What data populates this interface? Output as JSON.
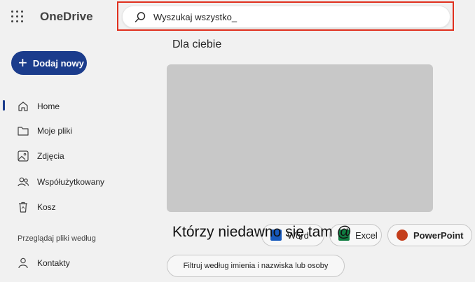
{
  "app": {
    "name": "OneDrive"
  },
  "search": {
    "value": "Wyszukaj wszystko"
  },
  "add_button": {
    "label": "Dodaj nowy"
  },
  "nav": {
    "items": [
      {
        "label": "Home",
        "icon": "home-icon",
        "active": true
      },
      {
        "label": "Moje pliki",
        "icon": "folder-icon"
      },
      {
        "label": "Zdjęcia",
        "icon": "image-icon"
      },
      {
        "label": "Współużytkowany",
        "icon": "people-icon"
      },
      {
        "label": "Kosz",
        "icon": "recycle-bin-icon"
      }
    ],
    "browse_section": "Przeglądaj pliki według",
    "contacts": {
      "label": "Kontakty",
      "icon": "person-icon"
    }
  },
  "main": {
    "heading": "Dla ciebie",
    "recent_overlay": "Którzy niedawno się tam @",
    "app_chips": [
      {
        "label": "Word",
        "icon": "word-icon"
      },
      {
        "label": "Excel",
        "icon": "excel-icon"
      },
      {
        "label": "PowerPoint",
        "icon": "powerpoint-icon"
      }
    ],
    "filter_label": "Filtruj według imienia i nazwiska lub osoby"
  },
  "colors": {
    "accent": "#1b3c8c",
    "highlight_outline": "#e0301e",
    "word": "#185abd",
    "excel": "#107c41",
    "powerpoint": "#c43e1c"
  }
}
